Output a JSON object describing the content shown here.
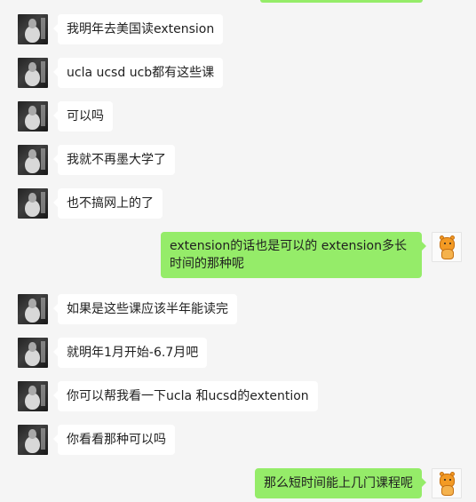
{
  "chat": {
    "messages": [
      {
        "sender": "user",
        "avatar": "user-avatar",
        "text": "我明年去美国读extension"
      },
      {
        "sender": "user",
        "avatar": "user-avatar",
        "text": "ucla ucsd ucb都有这些课"
      },
      {
        "sender": "user",
        "avatar": "user-avatar",
        "text": "可以吗"
      },
      {
        "sender": "user",
        "avatar": "user-avatar",
        "text": "我就不再墨大学了"
      },
      {
        "sender": "user",
        "avatar": "user-avatar",
        "text": "也不搞网上的了"
      },
      {
        "sender": "me",
        "avatar": "tiger-avatar",
        "text": "extension的话也是可以的 extension多长时间的那种呢"
      },
      {
        "sender": "user",
        "avatar": "user-avatar",
        "text": "如果是这些课应该半年能读完"
      },
      {
        "sender": "user",
        "avatar": "user-avatar",
        "text": "就明年1月开始-6.7月吧"
      },
      {
        "sender": "user",
        "avatar": "user-avatar",
        "text": "你可以帮我看一下ucla 和ucsd的extention"
      },
      {
        "sender": "user",
        "avatar": "user-avatar",
        "text": "你看看那种可以吗"
      },
      {
        "sender": "me",
        "avatar": "tiger-avatar",
        "text": "那么短时间能上几门课程呢"
      }
    ]
  },
  "colors": {
    "background": "#f5f5f5",
    "incoming_bubble": "#ffffff",
    "outgoing_bubble": "#95ec69",
    "text": "#1f1f1f"
  }
}
